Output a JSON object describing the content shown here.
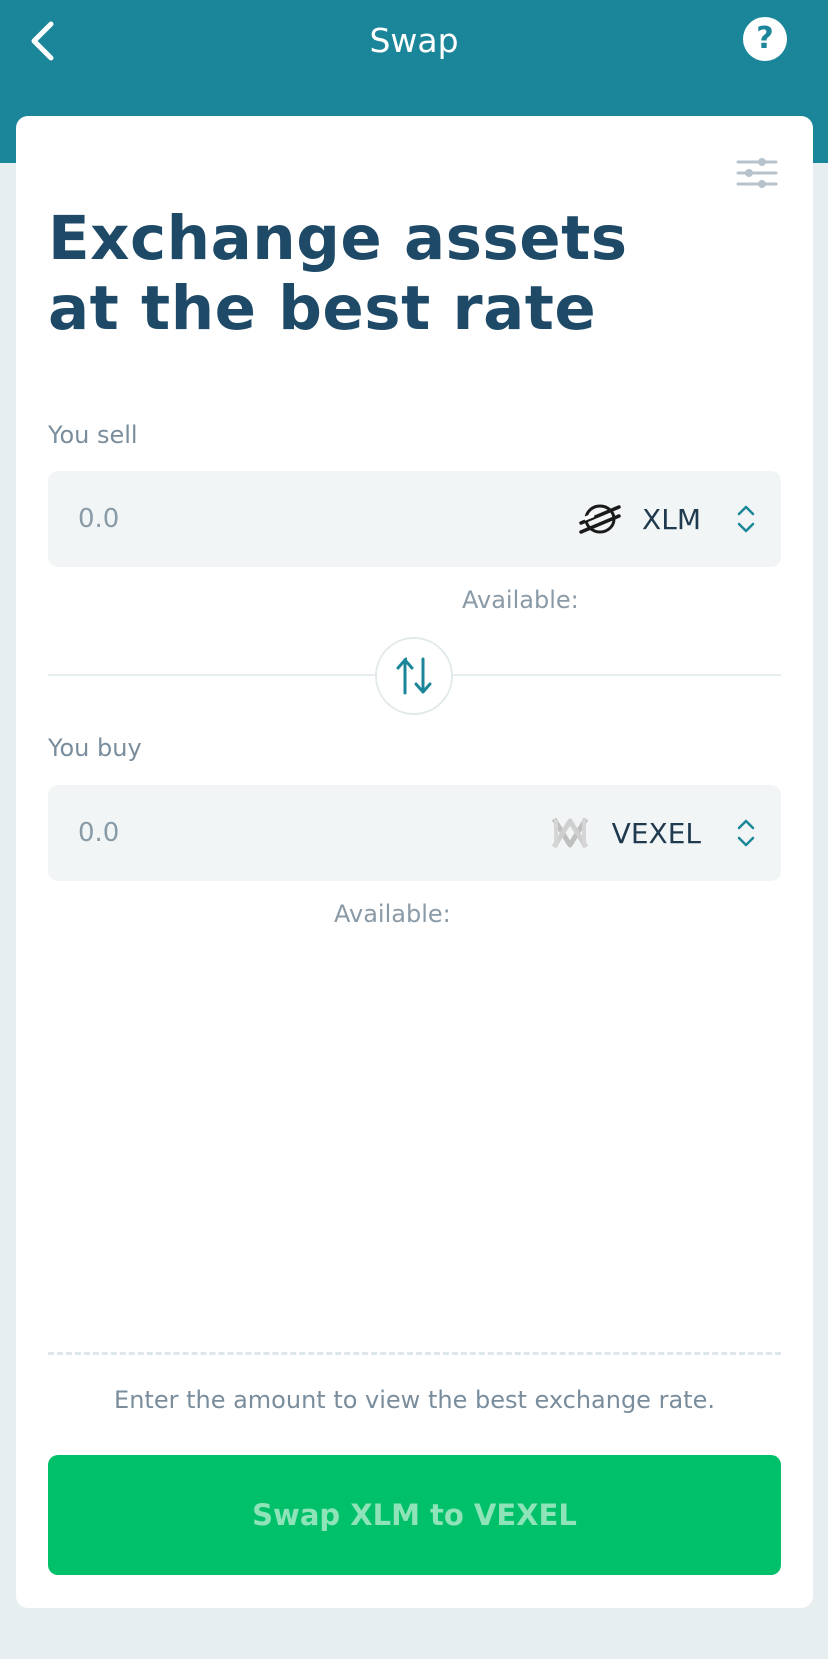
{
  "header": {
    "title": "Swap",
    "help_label": "?"
  },
  "main": {
    "headline": "Exchange assets at the best rate",
    "sell": {
      "label": "You sell",
      "amount_placeholder": "0.0",
      "asset_code": "XLM",
      "asset_icon": "stellar-logo-icon",
      "available_label": "Available:"
    },
    "buy": {
      "label": "You buy",
      "amount_placeholder": "0.0",
      "asset_code": "VEXEL",
      "asset_icon": "vexel-logo-icon",
      "available_label": "Available:"
    },
    "hint": "Enter the amount to view the best exchange rate.",
    "cta_label": "Swap XLM to VEXEL"
  },
  "colors": {
    "header_bg": "#1b8699",
    "heading": "#1f4a67",
    "cta_bg": "#00c16a",
    "input_bg": "#f1f5f6"
  }
}
